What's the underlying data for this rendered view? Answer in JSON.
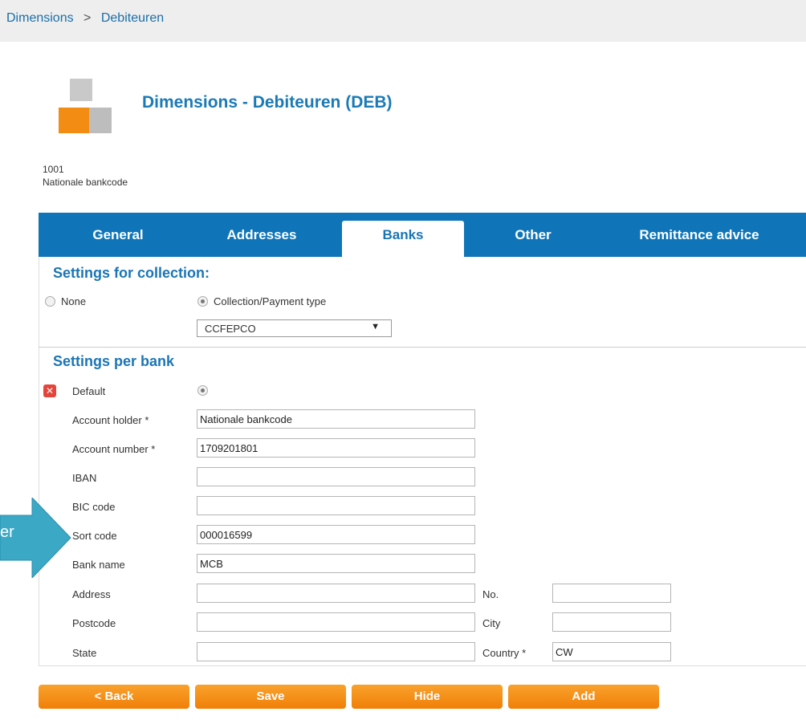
{
  "breadcrumb": {
    "items": [
      "Dimensions",
      "Debiteuren"
    ],
    "separator": ">"
  },
  "page": {
    "title": "Dimensions - Debiteuren (DEB)",
    "code": "1001",
    "name": "Nationale bankcode"
  },
  "tabs": [
    {
      "label": "General"
    },
    {
      "label": "Addresses"
    },
    {
      "label": "Banks",
      "active": true
    },
    {
      "label": "Other"
    },
    {
      "label": "Remittance advice"
    }
  ],
  "collection": {
    "heading": "Settings for collection:",
    "option_none": "None",
    "option_collection": "Collection/Payment type",
    "selected_option": "Collection/Payment type",
    "payment_type": "CCFEPCO"
  },
  "bank": {
    "heading": "Settings per bank",
    "default_label": "Default",
    "fields": {
      "account_holder": {
        "label": "Account holder *",
        "value": "Nationale bankcode"
      },
      "account_number": {
        "label": "Account number *",
        "value": "1709201801"
      },
      "iban": {
        "label": "IBAN",
        "value": ""
      },
      "bic": {
        "label": "BIC code",
        "value": ""
      },
      "sort_code": {
        "label": "Sort code",
        "value": "000016599"
      },
      "bank_name": {
        "label": "Bank name",
        "value": "MCB"
      },
      "address": {
        "label": "Address",
        "value": ""
      },
      "number": {
        "label": "No.",
        "value": ""
      },
      "postcode": {
        "label": "Postcode",
        "value": ""
      },
      "city": {
        "label": "City",
        "value": ""
      },
      "state": {
        "label": "State",
        "value": ""
      },
      "country": {
        "label": "Country *",
        "value": "CW"
      }
    }
  },
  "buttons": {
    "back": "< Back",
    "save": "Save",
    "hide": "Hide",
    "add": "Add"
  },
  "callout": {
    "text": "er",
    "color": "#3ba8c6"
  },
  "colors": {
    "accent": "#0f75b8",
    "button": "#f28c13",
    "title": "#1b7ab6",
    "delete": "#e4453a"
  }
}
